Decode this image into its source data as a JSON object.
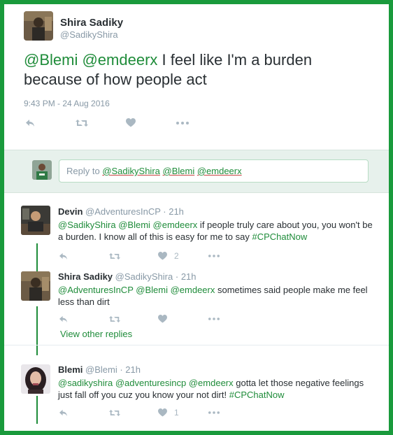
{
  "main_tweet": {
    "name": "Shira Sadiky",
    "handle": "@SadikyShira",
    "mention_1": "@Blemi",
    "mention_2": "@emdeerx",
    "text": " I feel like I'm a burden because of how people act",
    "timestamp": "9:43 PM - 24 Aug 2016"
  },
  "reply_box": {
    "prefix": "Reply to ",
    "mentions": [
      "@SadikyShira",
      "@Blemi",
      "@emdeerx"
    ]
  },
  "replies": [
    {
      "name": "Devin",
      "handle": "@AdventuresInCP",
      "time": "21h",
      "mentions": [
        "@SadikyShira",
        "@Blemi",
        "@emdeerx"
      ],
      "text": " if people truly care about you, you won't be a burden. I know all of this is easy for me to say ",
      "hashtag": "#CPChatNow",
      "like_count": "2"
    },
    {
      "name": "Shira Sadiky",
      "handle": "@SadikyShira",
      "time": "21h",
      "mentions": [
        "@AdventuresInCP",
        "@Blemi",
        "@emdeerx"
      ],
      "text": " sometimes said people make me feel less than dirt",
      "view_other": "View other replies"
    },
    {
      "name": "Blemi",
      "handle": "@Blemi",
      "time": "21h",
      "mentions": [
        "@sadikyshira",
        "@adventuresincp",
        "@emdeerx"
      ],
      "text": " gotta let those negative feelings just fall off you cuz you know your not dirt! ",
      "hashtag": "#CPChatNow",
      "like_count": "1"
    }
  ],
  "separator": " · ",
  "colors": {
    "border": "#1a9a3c",
    "link": "#1f8c3a",
    "muted": "#8899a6",
    "icon": "#aab8c2",
    "reply_bg": "#e7f1ec"
  }
}
